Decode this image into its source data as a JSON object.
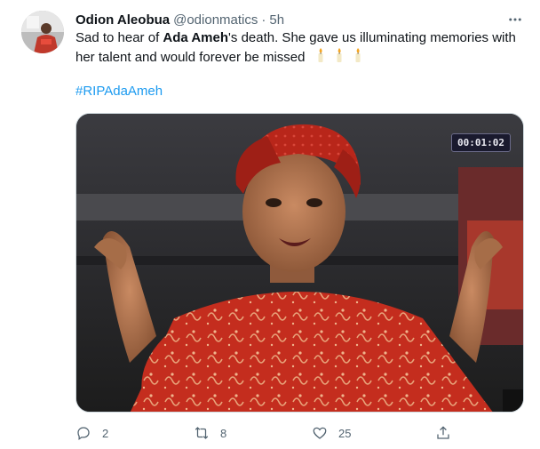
{
  "tweet": {
    "author_name": "Odion Aleobua",
    "handle": "@odionmatics",
    "separator": "·",
    "time": "5h",
    "text_part1": "Sad to hear of ",
    "text_bold": "Ada Ameh",
    "text_part2": "'s death. She gave us illuminating memories with her talent and would forever be missed",
    "candle_emoji_count": 3,
    "hashtag": "#RIPAdaAmeh",
    "video_timestamp": "00:01:02",
    "counts": {
      "replies": "2",
      "retweets": "8",
      "likes": "25"
    }
  },
  "icons": {
    "more": "more-icon",
    "reply": "reply-icon",
    "retweet": "retweet-icon",
    "like": "heart-icon",
    "share": "share-icon",
    "candle": "candle-icon"
  },
  "colors": {
    "link": "#1d9bf0",
    "secondary_text": "#536471",
    "primary_text": "#0f1419"
  }
}
